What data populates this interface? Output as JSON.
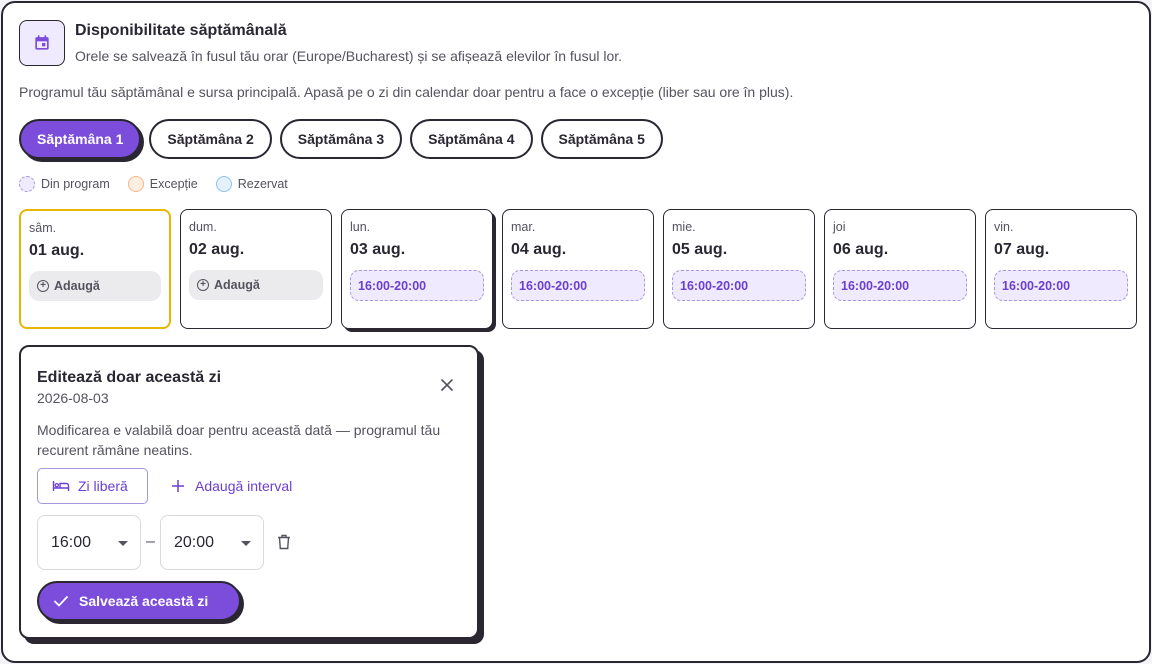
{
  "header": {
    "title": "Disponibilitate săptămânală",
    "subtitle": "Orele se salvează în fusul tău orar (Europe/Bucharest) și se afișează elevilor în fusul lor.",
    "icon": "calendar-icon"
  },
  "intro": "Programul tău săptămânal e sursa principală. Apasă pe o zi din calendar doar pentru a face o excepție (liber sau ore în plus).",
  "tabs": [
    {
      "label": "Săptămâna 1",
      "active": true
    },
    {
      "label": "Săptămâna 2",
      "active": false
    },
    {
      "label": "Săptămâna 3",
      "active": false
    },
    {
      "label": "Săptămâna 4",
      "active": false
    },
    {
      "label": "Săptămâna 5",
      "active": false
    }
  ],
  "legend": [
    {
      "label": "Din program",
      "color": "#efeafd"
    },
    {
      "label": "Excepție",
      "color": "#fdeee2"
    },
    {
      "label": "Rezervat",
      "color": "#e3f1fd"
    }
  ],
  "days": [
    {
      "name": "sâm.",
      "date": "01 aug.",
      "add_label": "Adaugă"
    },
    {
      "name": "dum.",
      "date": "02 aug.",
      "add_label": "Adaugă"
    },
    {
      "name": "lun.",
      "date": "03 aug.",
      "slot": "16:00-20:00"
    },
    {
      "name": "mar.",
      "date": "04 aug.",
      "slot": "16:00-20:00"
    },
    {
      "name": "mie.",
      "date": "05 aug.",
      "slot": "16:00-20:00"
    },
    {
      "name": "joi",
      "date": "06 aug.",
      "slot": "16:00-20:00"
    },
    {
      "name": "vin.",
      "date": "07 aug.",
      "slot": "16:00-20:00"
    }
  ],
  "editor": {
    "title": "Editează doar această zi",
    "date": "2026-08-03",
    "note": "Modificarea e valabilă doar pentru această dată — programul tău recurent rămâne neatins.",
    "free_day_label": "Zi liberă",
    "add_interval_label": "Adaugă interval",
    "start_time": "16:00",
    "end_time": "20:00",
    "separator": "–",
    "save_label": "Salvează această zi"
  },
  "colors": {
    "accent": "#7c4ddb",
    "ink": "#2a2733",
    "today_border": "#e8b600"
  }
}
